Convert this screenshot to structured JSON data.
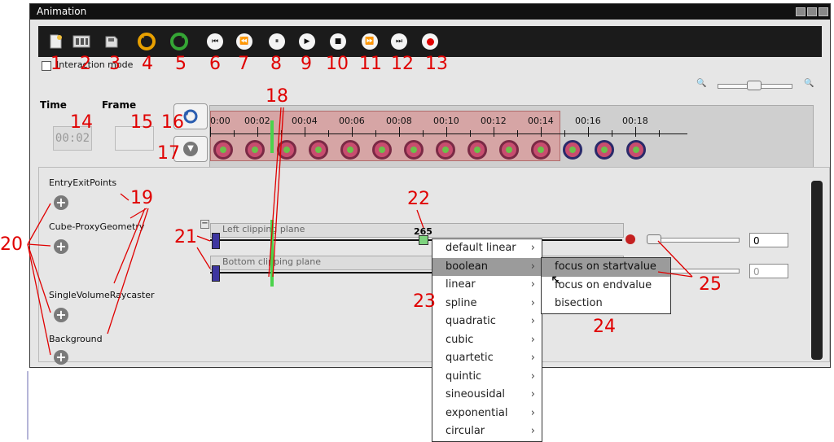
{
  "window": {
    "title": "Animation"
  },
  "toolbar": {
    "interaction_mode_label": "Interaction mode",
    "icons": [
      "new-icon",
      "image-icon",
      "save-icon",
      "undo-icon",
      "redo-icon",
      "skip-start-icon",
      "rewind-icon",
      "pause-icon",
      "play-icon",
      "stop-icon",
      "fast-forward-icon",
      "skip-end-icon",
      "record-icon"
    ]
  },
  "annotations": {
    "n1": "1",
    "n2": "2",
    "n3": "3",
    "n4": "4",
    "n5": "5",
    "n6": "6",
    "n7": "7",
    "n8": "8",
    "n9": "9",
    "n10": "10",
    "n11": "11",
    "n12": "12",
    "n13": "13",
    "n14": "14",
    "n15": "15",
    "n16": "16",
    "n17": "17",
    "n18": "18",
    "n19": "19",
    "n20": "20",
    "n21": "21",
    "n22": "22",
    "n23": "23",
    "n24": "24",
    "n25": "25"
  },
  "labels": {
    "time": "Time",
    "frame": "Frame",
    "time_value": "00:02"
  },
  "timeline": {
    "ticks": [
      "0:00",
      "00:02",
      "00:04",
      "00:06",
      "00:08",
      "00:10",
      "00:12",
      "00:14",
      "00:16",
      "00:18"
    ],
    "keyframe_count": 14
  },
  "properties": {
    "groups": [
      "EntryExitPoints",
      "Cube-ProxyGeometry",
      "SingleVolumeRaycaster",
      "Background"
    ],
    "tracks": [
      "Left clipping plane",
      "Bottom clipping plane"
    ],
    "cursor_value": "265",
    "spin1": "0",
    "spin2": "0"
  },
  "menu": {
    "items": [
      "default linear",
      "boolean",
      "linear",
      "spline",
      "quadratic",
      "cubic",
      "quartetic",
      "quintic",
      "sineousidal",
      "exponential",
      "circular"
    ],
    "selected": "boolean"
  },
  "submenu": {
    "items": [
      "focus on startvalue",
      "focus on endvalue",
      "bisection"
    ],
    "selected": "focus on startvalue"
  }
}
